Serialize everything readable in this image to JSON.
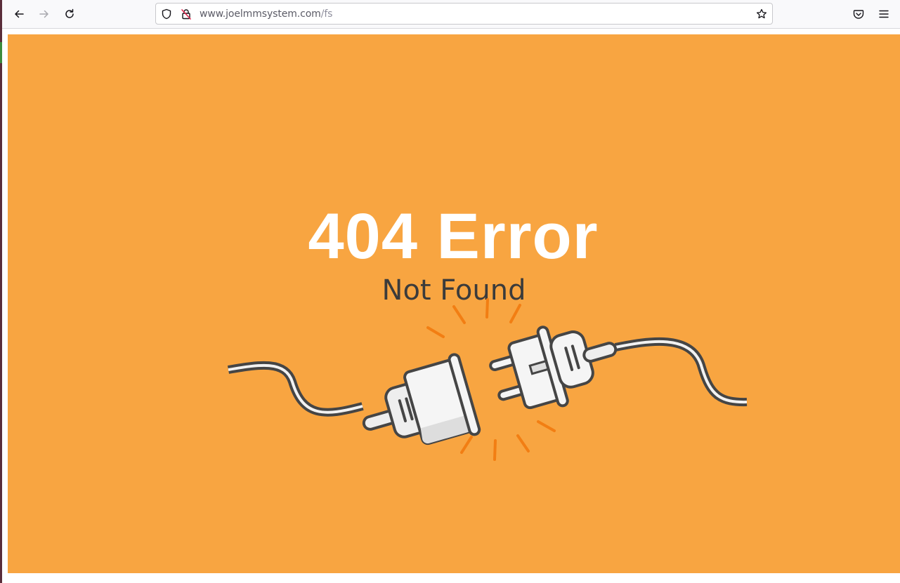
{
  "browser": {
    "back_icon": "arrow-left-icon",
    "forward_icon": "arrow-right-icon",
    "reload_icon": "reload-icon",
    "url": {
      "host": "www.joelmmsystem.com",
      "path": "/fs"
    },
    "bookmark_icon": "star-icon",
    "pocket_icon": "pocket-icon",
    "menu_icon": "hamburger-menu-icon"
  },
  "page": {
    "title": "404 Error",
    "subtitle": "Not Found",
    "background_color": "#f8a541",
    "illustration": "unplugged-power-plug-icon"
  }
}
